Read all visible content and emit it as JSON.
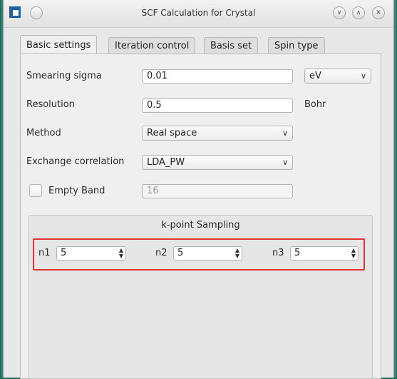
{
  "window": {
    "title": "SCF Calculation for Crystal"
  },
  "tabs": [
    {
      "label": "Basic settings",
      "active": true
    },
    {
      "label": "Iteration control",
      "active": false
    },
    {
      "label": "Basis set",
      "active": false
    },
    {
      "label": "Spin type",
      "active": false
    }
  ],
  "form": {
    "smearing": {
      "label": "Smearing sigma",
      "value": "0.01",
      "unit": "eV"
    },
    "resolution": {
      "label": "Resolution",
      "value": "0.5",
      "unit": "Bohr"
    },
    "method": {
      "label": "Method",
      "value": "Real space"
    },
    "xc": {
      "label": "Exchange correlation",
      "value": "LDA_PW"
    },
    "empty_band": {
      "label": "Empty Band",
      "checked": false,
      "value": "16"
    }
  },
  "kpoint": {
    "title": "k-point Sampling",
    "n1": {
      "label": "n1",
      "value": "5"
    },
    "n2": {
      "label": "n2",
      "value": "5"
    },
    "n3": {
      "label": "n3",
      "value": "5"
    }
  },
  "icons": {
    "app": "app-logo-icon",
    "menu": "window-menu-icon",
    "minimize": "chevron-down-icon",
    "maximize": "chevron-up-icon",
    "close": "close-icon"
  },
  "colors": {
    "highlight": "#e23232",
    "desktop": "#1f6b5c"
  }
}
